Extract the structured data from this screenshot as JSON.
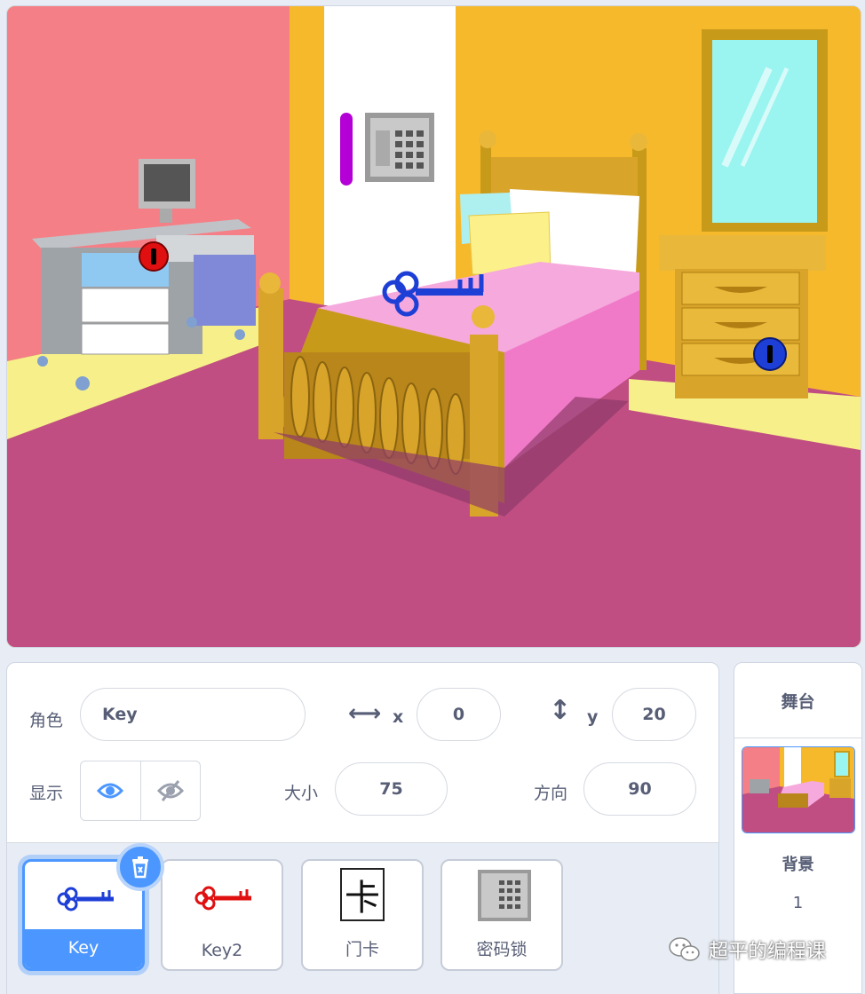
{
  "sprite_info": {
    "sprite_label": "角色",
    "sprite_name": "Key",
    "x_label": "x",
    "x_value": "0",
    "y_label": "y",
    "y_value": "20",
    "show_label": "显示",
    "size_label": "大小",
    "size_value": "75",
    "direction_label": "方向",
    "direction_value": "90"
  },
  "sprites": [
    {
      "name": "Key",
      "selected": true
    },
    {
      "name": "Key2"
    },
    {
      "name": "门卡",
      "glyph": "卡"
    },
    {
      "name": "密码锁"
    }
  ],
  "stage_panel": {
    "title": "舞台",
    "backdrop_label": "背景",
    "backdrop_count": "1"
  },
  "watermark": "超平的编程课",
  "colors": {
    "accent": "#4c97ff",
    "text": "#575e75",
    "key_blue": "#1e3fd6",
    "key_red": "#e01010"
  },
  "icons": [
    "eye-icon",
    "eye-off-icon",
    "arrows-horizontal-icon",
    "arrows-vertical-icon",
    "trash-icon",
    "wechat-icon"
  ]
}
